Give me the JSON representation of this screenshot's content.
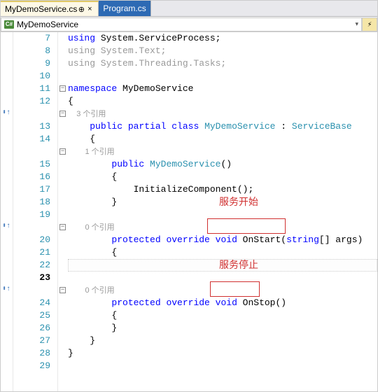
{
  "tabs": {
    "active": "MyDemoService.cs",
    "inactive": "Program.cs"
  },
  "navbar": {
    "class": "MyDemoService",
    "cs_badge": "C#"
  },
  "lines": [
    "7",
    "8",
    "9",
    "10",
    "11",
    "12",
    "13",
    "14",
    "15",
    "16",
    "17",
    "18",
    "19",
    "20",
    "21",
    "22",
    "23",
    "24",
    "25",
    "26",
    "27",
    "28",
    "29"
  ],
  "code": {
    "l7": {
      "k1": "using",
      "t1": " System.ServiceProcess;"
    },
    "l8": {
      "g1": "using System.Text;"
    },
    "l9": {
      "g1": "using System.Threading.Tasks;"
    },
    "l11": {
      "k1": "namespace",
      "t1": " MyDemoService"
    },
    "l12": "{",
    "cl1": "3 个引用",
    "l13": {
      "k1": "public",
      "k2": " partial",
      "k3": " class",
      "c1": " MyDemoService",
      "t1": " : ",
      "c2": "ServiceBase"
    },
    "l14": "{",
    "cl2": "1 个引用",
    "l15": {
      "k1": "public",
      "c1": " MyDemoService",
      "t1": "()"
    },
    "l16": "{",
    "l17": "InitializeComponent();",
    "l18": "}",
    "cl3": "0 个引用",
    "l20": {
      "k1": "protected",
      "k2": " override",
      "k3": " void",
      "t1": " OnStart(",
      "k4": "string",
      "t2": "[] args)"
    },
    "l21": "{",
    "l22": "}",
    "cl4": "0 个引用",
    "l24": {
      "k1": "protected",
      "k2": " override",
      "k3": " void",
      "t1": " OnStop()"
    },
    "l25": "{",
    "l26": "}",
    "l27": "}",
    "l28": "}"
  },
  "annotations": {
    "start": "服务开始",
    "stop": "服务停止"
  },
  "icons": {
    "pin": "⊕",
    "close": "×",
    "impl": "⬍↑",
    "member": "⚡"
  }
}
